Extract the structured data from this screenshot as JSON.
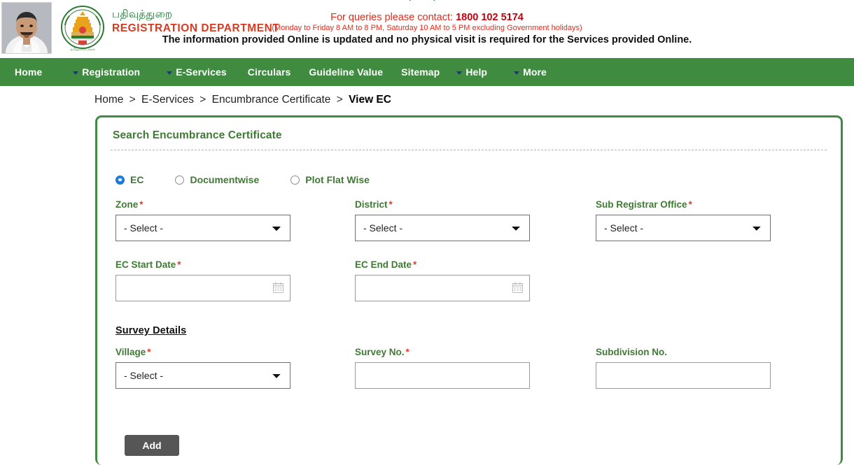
{
  "header": {
    "portrait_alt": "chief-minister-photo",
    "emblem_alt": "tamil-nadu-state-emblem",
    "dept_tamil": "பதிவுத்துறை",
    "dept_english": "REGISTRATION DEPARTMENT",
    "cut_text": "|  |",
    "contact_prefix": "For queries please contact: ",
    "contact_number": "1800 102 5174",
    "contact_hours": "(Monday to Friday 8 AM to 8 PM, Saturday 10 AM to 5 PM excluding Government holidays)",
    "notice": "The information provided Online is updated and no physical visit is required for the Services provided Online."
  },
  "nav": {
    "items": [
      {
        "label": "Home",
        "caret": false
      },
      {
        "label": "Registration",
        "caret": true
      },
      {
        "label": "E-Services",
        "caret": true
      },
      {
        "label": "Circulars",
        "caret": false
      },
      {
        "label": "Guideline Value",
        "caret": false
      },
      {
        "label": "Sitemap",
        "caret": false
      },
      {
        "label": "Help",
        "caret": true
      },
      {
        "label": "More",
        "caret": true
      }
    ]
  },
  "breadcrumb": {
    "items": [
      "Home",
      "E-Services",
      "Encumbrance Certificate"
    ],
    "current": "View EC",
    "separator": ">"
  },
  "panel": {
    "title": "Search Encumbrance Certificate"
  },
  "search_type": {
    "options": [
      {
        "label": "EC",
        "selected": true
      },
      {
        "label": "Documentwise",
        "selected": false
      },
      {
        "label": "Plot Flat Wise",
        "selected": false
      }
    ]
  },
  "form": {
    "select_placeholder": "- Select -",
    "required_mark": "*",
    "zone": {
      "label": "Zone",
      "required": true,
      "value": "- Select -"
    },
    "district": {
      "label": "District",
      "required": true,
      "value": "- Select -"
    },
    "sub_registrar_office": {
      "label": "Sub Registrar Office",
      "required": true,
      "value": "- Select -"
    },
    "ec_start_date": {
      "label": "EC Start Date",
      "required": true,
      "value": "",
      "placeholder": ""
    },
    "ec_end_date": {
      "label": "EC End Date",
      "required": true,
      "value": "",
      "placeholder": ""
    },
    "survey_heading": "Survey Details",
    "village": {
      "label": "Village",
      "required": true,
      "value": "- Select -"
    },
    "survey_no": {
      "label": "Survey No.",
      "required": true,
      "value": "",
      "placeholder": ""
    },
    "subdivision_no": {
      "label": "Subdivision No.",
      "required": false,
      "value": "",
      "placeholder": ""
    },
    "add_button": "Add"
  }
}
